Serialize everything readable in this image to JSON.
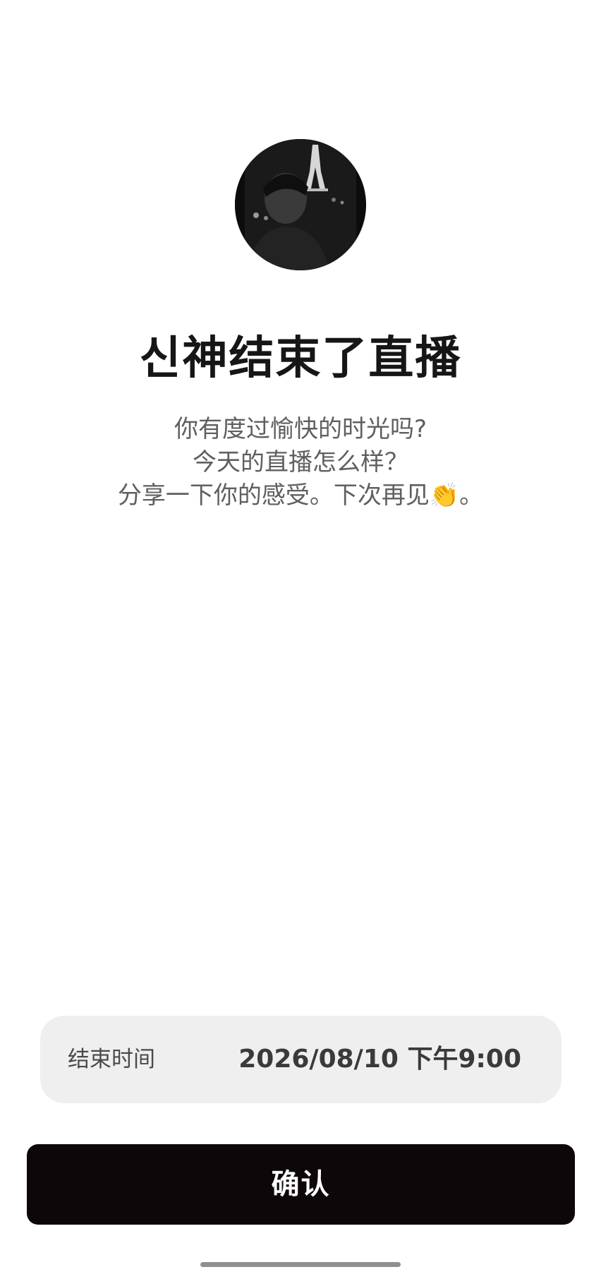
{
  "avatar": {
    "icon": "profile-photo"
  },
  "title": "신神结束了直播",
  "message": {
    "line1": "你有度过愉快的时光吗?",
    "line2": "今天的直播怎么样？",
    "line3": "分享一下你的感受。下次再见👏。"
  },
  "end_time": {
    "label": "结束时间",
    "value": "2026/08/10 下午9:00"
  },
  "confirm_label": "确认",
  "colors": {
    "button_bg": "#0d070a",
    "card_bg": "#efefef",
    "message_text": "#5f5f5f"
  }
}
